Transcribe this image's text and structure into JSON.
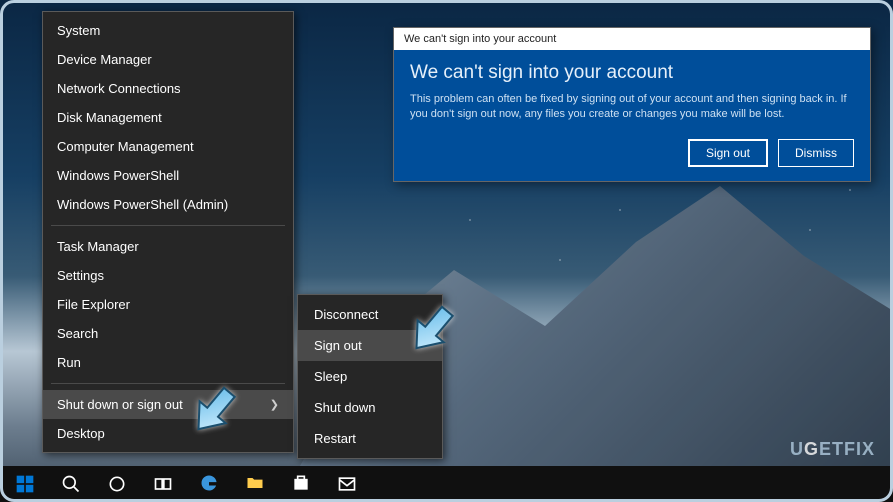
{
  "dialog": {
    "titlebar": "We can't sign into your account",
    "heading": "We can't sign into your account",
    "body": "This problem can often be fixed by signing out of your account and then signing back in. If you don't sign out now, any files you create or changes you make will be lost.",
    "sign_out": "Sign out",
    "dismiss": "Dismiss"
  },
  "winx": {
    "group1": [
      "System",
      "Device Manager",
      "Network Connections",
      "Disk Management",
      "Computer Management",
      "Windows PowerShell",
      "Windows PowerShell (Admin)"
    ],
    "group2": [
      "Task Manager",
      "Settings",
      "File Explorer",
      "Search",
      "Run"
    ],
    "shutdown": "Shut down or sign out",
    "desktop": "Desktop"
  },
  "submenu": {
    "items": [
      "Disconnect",
      "Sign out",
      "Sleep",
      "Shut down",
      "Restart"
    ],
    "highlight_index": 1
  },
  "watermark": "UGETFIX"
}
